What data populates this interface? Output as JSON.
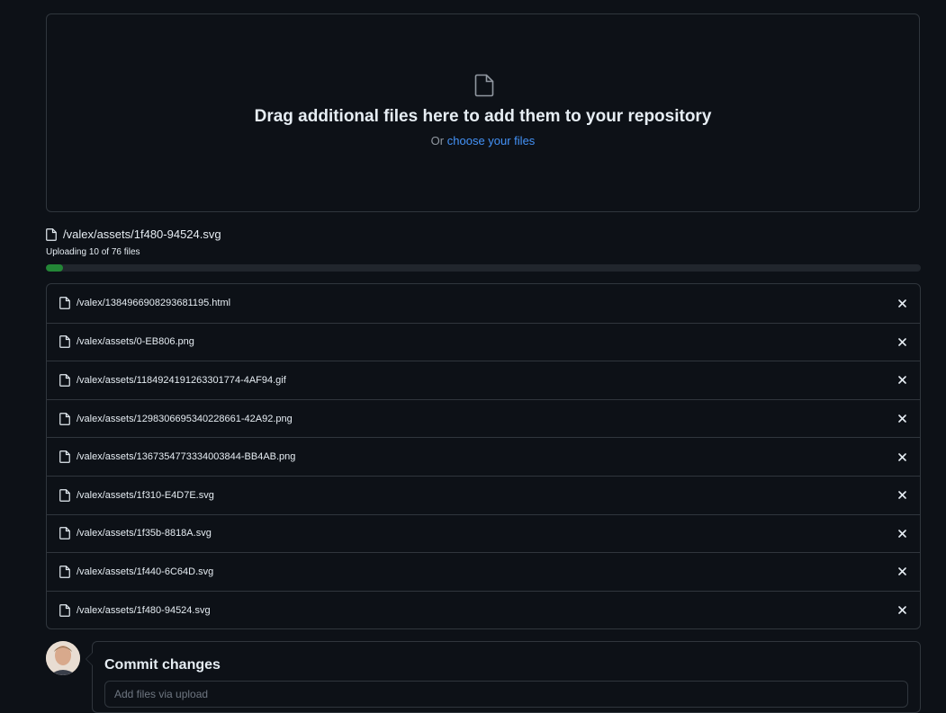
{
  "dropzone": {
    "title": "Drag additional files here to add them to your repository",
    "or_text": "Or",
    "choose_link": "choose your files"
  },
  "upload": {
    "current_file": "/valex/assets/1f480-94524.svg",
    "status_text": "Uploading 10 of 76 files",
    "progress_fraction": 0.02,
    "progress_color": "#238636"
  },
  "files": [
    {
      "name": "/valex/1384966908293681195.html"
    },
    {
      "name": "/valex/assets/0-EB806.png"
    },
    {
      "name": "/valex/assets/1184924191263301774-4AF94.gif"
    },
    {
      "name": "/valex/assets/1298306695340228661-42A92.png"
    },
    {
      "name": "/valex/assets/1367354773334003844-BB4AB.png"
    },
    {
      "name": "/valex/assets/1f310-E4D7E.svg"
    },
    {
      "name": "/valex/assets/1f35b-8818A.svg"
    },
    {
      "name": "/valex/assets/1f440-6C64D.svg"
    },
    {
      "name": "/valex/assets/1f480-94524.svg"
    }
  ],
  "commit": {
    "title": "Commit changes",
    "message_placeholder": "Add files via upload"
  },
  "icons": {
    "file": "file-icon",
    "remove": "x-icon"
  }
}
